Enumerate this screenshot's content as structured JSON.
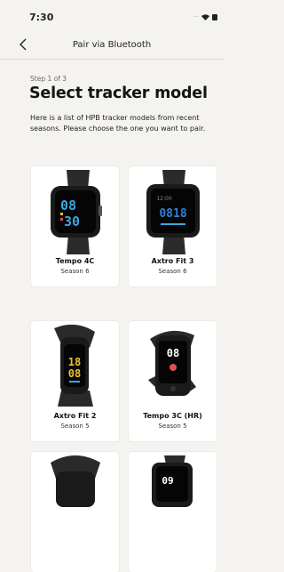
{
  "status_bar": {
    "time": "7:30",
    "signal": "···"
  },
  "nav": {
    "title": "Pair via Bluetooth",
    "back_icon": "chevron-left-icon"
  },
  "header": {
    "step": "Step 1 of 3",
    "title": "Select tracker model",
    "description": "Here is a list of HPB tracker models from recent seasons. Please choose the one you want to pair."
  },
  "trackers": [
    {
      "name": "Tempo 4C",
      "season": "Season 6",
      "screen_top": "08",
      "screen_bottom": "30",
      "screen_color": "#3aa7e0"
    },
    {
      "name": "Axtro Fit 3",
      "season": "Season 6",
      "screen_top": "0818",
      "screen_bottom": "",
      "screen_color": "#2f7fd6"
    },
    {
      "name": "Axtro Fit 2",
      "season": "Season 5",
      "screen_top": "18",
      "screen_bottom": "08",
      "screen_color": "#f2c230"
    },
    {
      "name": "Tempo 3C (HR)",
      "season": "Season 5",
      "screen_top": "08",
      "screen_bottom": "",
      "screen_color": "#ffffff"
    },
    {
      "name": "",
      "season": "",
      "screen_top": "",
      "screen_bottom": "",
      "screen_color": "#ffffff"
    },
    {
      "name": "",
      "season": "",
      "screen_top": "09",
      "screen_bottom": "",
      "screen_color": "#ffffff"
    }
  ]
}
